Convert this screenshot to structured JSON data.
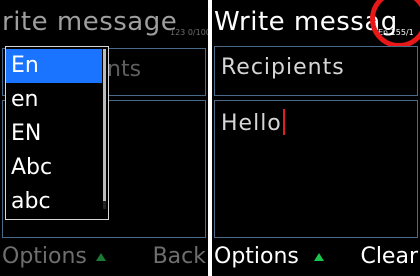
{
  "left": {
    "title": "rite message",
    "counter": "123 0/100",
    "recipients_visible": "nts",
    "softkeys": {
      "left": "Options",
      "right": "Back"
    },
    "dropdown": {
      "items": [
        "En",
        "en",
        "EN",
        "Abc",
        "abc"
      ],
      "selected_index": 0
    }
  },
  "right": {
    "title": "Write messag",
    "counter": "En 155/1",
    "recipients_placeholder": "Recipients",
    "message_text": "Hello",
    "softkeys": {
      "left": "Options",
      "right": "Clear"
    }
  },
  "colors": {
    "selection": "#1a74ff",
    "softkey_arrow": "#19c64a",
    "cursor": "#e02020",
    "highlight_circle": "#e81818",
    "field_border": "#4a6a8a"
  }
}
